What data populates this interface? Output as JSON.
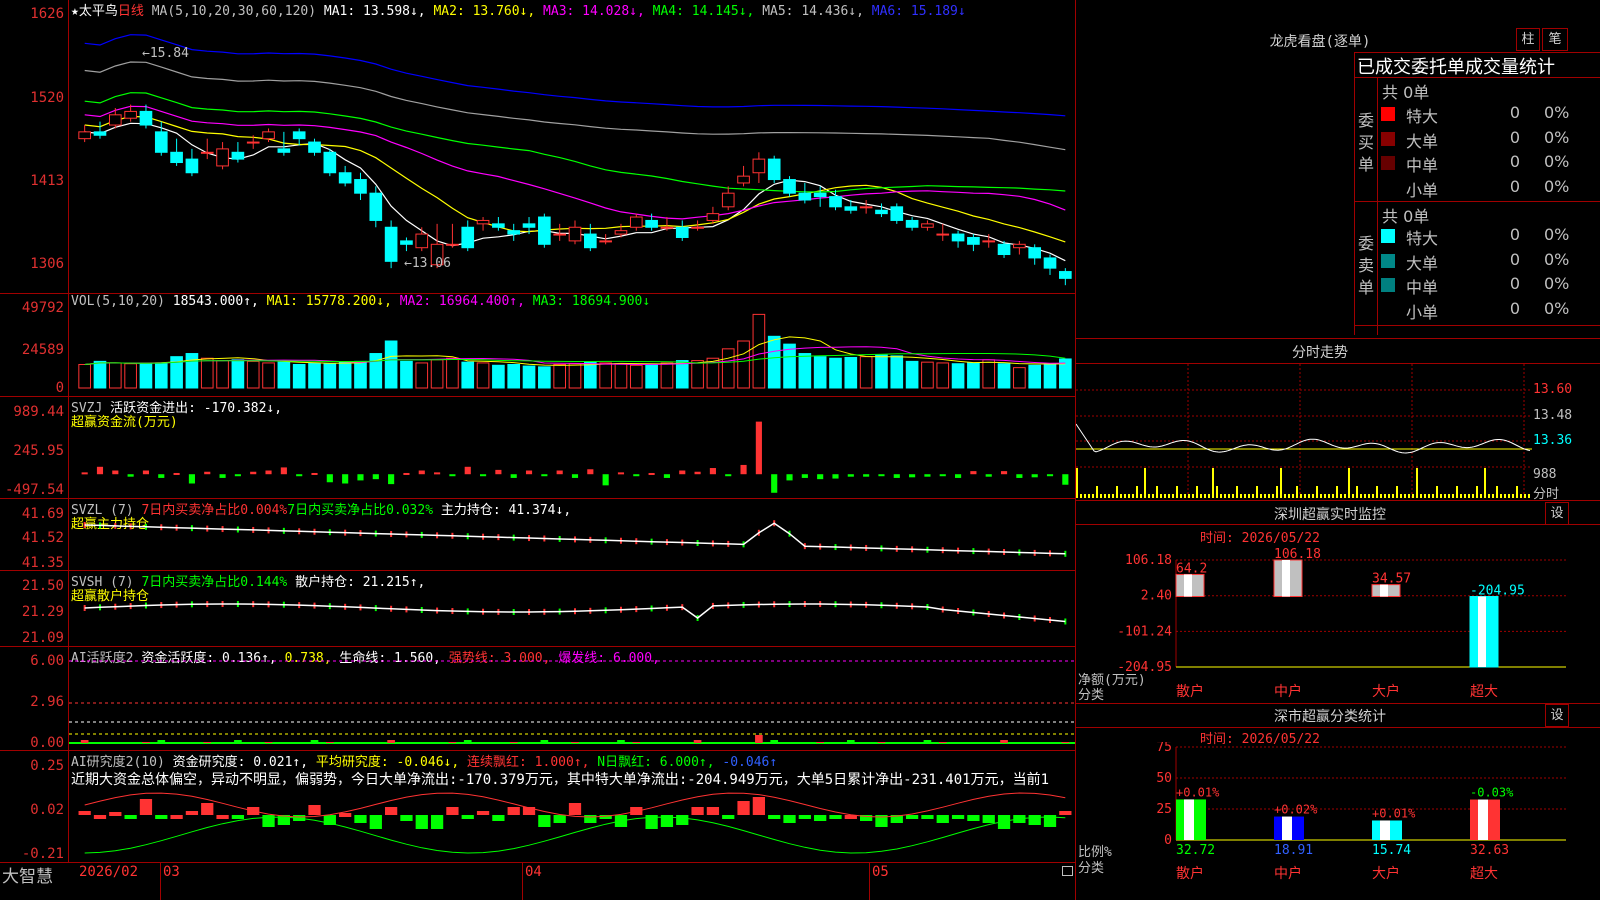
{
  "colors": {
    "up": "#ff3333",
    "down": "#00ffff",
    "grid": "#a00000",
    "ma1": "#ffffff",
    "ma2": "#ffff00",
    "ma3": "#ff00ff",
    "ma4": "#00ff00",
    "ma5": "#a0a0a0",
    "ma6": "#0000ff"
  },
  "main": {
    "star": "★",
    "stock_name": "太平鸟",
    "period": "日线",
    "ma_label": "MA(5,10,20,30,60,120)",
    "ma1": "MA1: 13.598↓,",
    "ma2": "MA2: 13.760↓,",
    "ma3": "MA3: 14.028↓,",
    "ma4": "MA4: 14.145↓,",
    "ma5": "MA5: 14.436↓,",
    "ma6": "MA6: 15.189↓",
    "yticks": [
      "1626",
      "1520",
      "1413",
      "1306"
    ],
    "high_marker": "←15.84",
    "low_marker": "←13.06"
  },
  "vol": {
    "label": "VOL(5,10,20)",
    "value": "18543.000↑,",
    "ma1": "MA1: 15778.200↓,",
    "ma2": "MA2: 16964.400↑,",
    "ma3": "MA3: 18694.900↓",
    "yticks": [
      "49792",
      "24589",
      "0"
    ]
  },
  "svzj": {
    "label": "SVZJ",
    "active": "活跃资金进出: -170.382↓,",
    "sub": "超赢资金流(万元)",
    "yticks": [
      "989.44",
      "245.95",
      "-497.54"
    ]
  },
  "svzl": {
    "label": "SVZL (7)",
    "net7": "7日内买卖净占比0.004%",
    "net7b": "7日内买卖净占比0.032%",
    "main_pos": "主力持仓: 41.374↓,",
    "sub": "超赢主力持仓",
    "yticks": [
      "41.69",
      "41.52",
      "41.35"
    ]
  },
  "svsh": {
    "label": "SVSH (7)",
    "net7": "7日内买卖净占比0.144%",
    "retail_pos": "散户持仓: 21.215↑,",
    "sub": "超赢散户持仓",
    "yticks": [
      "21.50",
      "21.29",
      "21.09"
    ]
  },
  "ai1": {
    "label": "AI活跃度2",
    "act": "资金活跃度: 0.136↑,",
    "v2": "0.738,",
    "life": "生命线: 1.560,",
    "strong": "强势线: 3.000,",
    "burst": "爆发线: 6.000,",
    "yticks": [
      "6.00",
      "2.96",
      "0.00"
    ]
  },
  "ai2": {
    "label": "AI研究度2(10)",
    "research": "资金研究度: 0.021↑,",
    "avg": "平均研究度: -0.046↓,",
    "cont": "连续飘红: 1.000↑,",
    "nday": "N日飘红: 6.000↑,",
    "tail": "-0.046↑",
    "summary": "近期大资金总体偏空，异动不明显，偏弱势，今日大单净流出:-170.379万元，其中特大单净流出:-204.949万元，大单5日累计净出-231.401万元，当前1",
    "yticks": [
      "0.25",
      "0.02",
      "-0.21"
    ]
  },
  "bottom": {
    "brand": "大智慧",
    "dates": [
      "2026/02",
      "03",
      "04",
      "05"
    ]
  },
  "longhu": {
    "title": "龙虎看盘(逐单)",
    "btn_bar": "柱",
    "btn_pen": "笔",
    "tabs": "已成交委托单成交量统计",
    "buy_label": [
      "委",
      "买",
      "单"
    ],
    "sell_label": [
      "委",
      "卖",
      "单"
    ],
    "buy_total": "共 0单",
    "sell_total": "共 0单",
    "rows": [
      {
        "label": "特大",
        "val": "0",
        "pct": "0%"
      },
      {
        "label": "大单",
        "val": "0",
        "pct": "0%"
      },
      {
        "label": "中单",
        "val": "0",
        "pct": "0%"
      },
      {
        "label": "小单",
        "val": "0",
        "pct": "0%"
      }
    ],
    "buy_colors": [
      "#ff0000",
      "#880000",
      "#660000",
      ""
    ],
    "sell_colors": [
      "#00ffff",
      "#008888",
      "#008080",
      ""
    ]
  },
  "intraday": {
    "title": "分时走势",
    "yticks": [
      "13.60",
      "13.48",
      "13.36"
    ],
    "vol_label": "988",
    "vol_unit": "分时"
  },
  "sz_monitor": {
    "title": "深圳超赢实时监控",
    "btn": "设",
    "time": "时间: 2026/05/22",
    "yticks": [
      "106.18",
      "2.40",
      "-101.24",
      "-204.95"
    ],
    "ylabel": "净额(万元)",
    "xlabel": "分类",
    "cats": [
      "散户",
      "中户",
      "大户",
      "超大"
    ],
    "values": [
      "64.2",
      "106.18",
      "34.57",
      "-204.95"
    ]
  },
  "sz_class": {
    "title": "深市超赢分类统计",
    "btn": "设",
    "time": "时间: 2026/05/22",
    "yticks": [
      "75",
      "50",
      "25",
      "0"
    ],
    "ylabel": "比例%",
    "xlabel": "分类",
    "cats": [
      "散户",
      "中户",
      "大户",
      "超大"
    ],
    "pct_change": [
      "+0.01%",
      "+0.02%",
      "+0.01%",
      "-0.03%"
    ],
    "values": [
      "32.72",
      "18.91",
      "15.74",
      "32.63"
    ]
  },
  "chart_data": [
    {
      "type": "candlestick",
      "title": "太平鸟 日线",
      "ylim": [
        1306,
        1626
      ],
      "note": "y tick values as printed",
      "open": [
        1460,
        1470,
        1480,
        1490,
        1500,
        1470,
        1440,
        1430,
        1440,
        1420,
        1440,
        1455,
        1460,
        1445,
        1470,
        1455,
        1440,
        1410,
        1400,
        1380,
        1330,
        1310,
        1300,
        1275,
        1305,
        1330,
        1335,
        1335,
        1325,
        1335,
        1345,
        1320,
        1310,
        1320,
        1310,
        1320,
        1330,
        1340,
        1330,
        1330,
        1330,
        1340,
        1360,
        1395,
        1410,
        1430,
        1400,
        1380,
        1380,
        1375,
        1360,
        1360,
        1355,
        1360,
        1340,
        1330,
        1320,
        1320,
        1315,
        1310,
        1305,
        1300,
        1300,
        1285,
        1265
      ],
      "close": [
        1470,
        1465,
        1495,
        1500,
        1480,
        1440,
        1425,
        1410,
        1440,
        1445,
        1430,
        1455,
        1470,
        1440,
        1460,
        1440,
        1410,
        1395,
        1380,
        1340,
        1280,
        1305,
        1320,
        1305,
        1305,
        1300,
        1340,
        1330,
        1320,
        1330,
        1305,
        1320,
        1330,
        1300,
        1310,
        1325,
        1345,
        1330,
        1330,
        1315,
        1330,
        1350,
        1380,
        1405,
        1430,
        1400,
        1380,
        1370,
        1375,
        1360,
        1355,
        1360,
        1350,
        1340,
        1330,
        1335,
        1320,
        1310,
        1305,
        1310,
        1290,
        1305,
        1285,
        1270,
        1255
      ],
      "high": [
        1480,
        1485,
        1505,
        1510,
        1510,
        1485,
        1460,
        1445,
        1460,
        1455,
        1455,
        1465,
        1475,
        1470,
        1475,
        1460,
        1445,
        1420,
        1410,
        1390,
        1340,
        1315,
        1330,
        1335,
        1335,
        1340,
        1345,
        1345,
        1335,
        1345,
        1350,
        1335,
        1340,
        1335,
        1320,
        1335,
        1350,
        1350,
        1345,
        1340,
        1340,
        1360,
        1390,
        1420,
        1440,
        1435,
        1405,
        1395,
        1390,
        1385,
        1370,
        1370,
        1365,
        1365,
        1345,
        1340,
        1335,
        1325,
        1320,
        1320,
        1310,
        1310,
        1305,
        1290,
        1270
      ],
      "low": [
        1455,
        1460,
        1475,
        1485,
        1475,
        1435,
        1420,
        1405,
        1430,
        1415,
        1425,
        1445,
        1455,
        1435,
        1450,
        1435,
        1405,
        1390,
        1370,
        1330,
        1270,
        1295,
        1295,
        1270,
        1300,
        1295,
        1325,
        1325,
        1310,
        1320,
        1300,
        1310,
        1305,
        1295,
        1305,
        1315,
        1325,
        1325,
        1325,
        1310,
        1325,
        1335,
        1355,
        1390,
        1395,
        1395,
        1375,
        1365,
        1360,
        1355,
        1350,
        1350,
        1345,
        1335,
        1325,
        1325,
        1310,
        1300,
        1295,
        1300,
        1285,
        1290,
        1275,
        1260,
        1245
      ]
    },
    {
      "type": "bar",
      "title": "VOL(5,10,20)",
      "ylim": [
        0,
        49792
      ],
      "values": [
        15000,
        17000,
        16000,
        15500,
        15800,
        16000,
        20000,
        22000,
        19000,
        17500,
        18000,
        17000,
        16000,
        16500,
        15000,
        16000,
        15500,
        16500,
        17000,
        22000,
        30000,
        17000,
        16000,
        18000,
        19000,
        16500,
        16000,
        14500,
        15000,
        14000,
        13500,
        15000,
        15500,
        16500,
        16000,
        15500,
        14500,
        15000,
        16000,
        17500,
        17500,
        19000,
        25000,
        30000,
        47000,
        33000,
        28000,
        22000,
        20000,
        19000,
        19500,
        20000,
        21000,
        20500,
        17000,
        16500,
        16000,
        15500,
        16000,
        18000,
        15500,
        13000,
        14500,
        15500,
        18543
      ]
    },
    {
      "type": "bar",
      "title": "SVZJ 活跃资金进出",
      "ylim": [
        -497.54,
        989.44
      ],
      "values": [
        30,
        120,
        60,
        -40,
        60,
        -60,
        20,
        -150,
        40,
        -60,
        -20,
        40,
        60,
        110,
        -10,
        20,
        -130,
        -150,
        -100,
        -80,
        -160,
        20,
        60,
        30,
        -20,
        120,
        -20,
        70,
        -60,
        60,
        -30,
        60,
        -60,
        80,
        -180,
        30,
        -30,
        20,
        -60,
        60,
        40,
        100,
        -10,
        150,
        850,
        -300,
        -100,
        -60,
        -80,
        -70,
        -40,
        -40,
        -30,
        -60,
        -50,
        -40,
        -30,
        -60,
        50,
        -40,
        50,
        -60,
        -50,
        -20,
        -170
      ]
    },
    {
      "type": "bar",
      "title": "超赢分类 净额(万元)",
      "categories": [
        "散户",
        "中户",
        "大户",
        "超大"
      ],
      "values": [
        64.2,
        106.18,
        34.57,
        -204.95
      ],
      "ylim": [
        -204.95,
        106.18
      ]
    },
    {
      "type": "bar",
      "title": "超赢分类 比例%",
      "categories": [
        "散户",
        "中户",
        "大户",
        "超大"
      ],
      "values": [
        32.72,
        18.91,
        15.74,
        32.63
      ],
      "ylim": [
        0,
        75
      ]
    }
  ]
}
